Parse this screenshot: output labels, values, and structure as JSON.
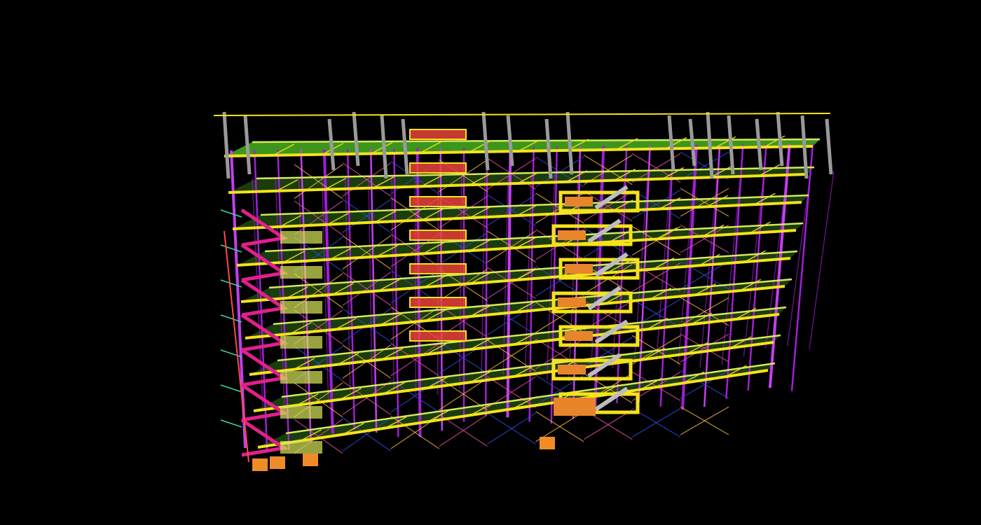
{
  "view": {
    "background": "#000000",
    "render_style": "3d-structural-model",
    "projection": "perspective",
    "palette": {
      "floor_slab": "#3f9e1e",
      "floor_slab_dark": "#2d6f16",
      "beam": "#f5e21c",
      "beam_secondary": "#d8e85a",
      "column": "#a01fd6",
      "column_bright": "#c23ff0",
      "bracing": "#f3b23a",
      "bracing_alt": "#e04ea0",
      "bracing_blue": "#2e4bd8",
      "stair_stringer": "#e0208c",
      "stair_tread": "#bdbdbd",
      "stair_landing": "#e8852a",
      "shaft_fill": "#e8433a",
      "roof_post": "#9a9a9a",
      "railing": "#3fd1a8",
      "footing": "#f08c28"
    },
    "elements": {
      "levels": 8,
      "stair_towers": 2,
      "openings": 1
    }
  }
}
